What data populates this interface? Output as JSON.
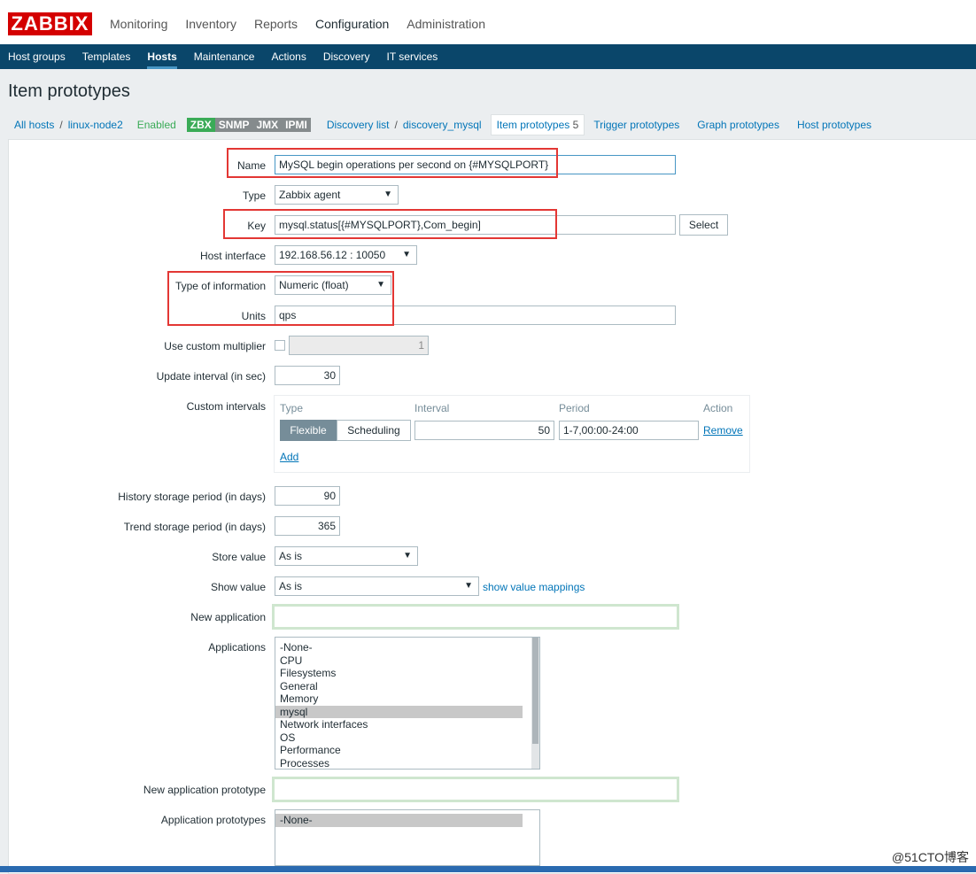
{
  "logo": "ZABBIX",
  "main_nav": [
    "Monitoring",
    "Inventory",
    "Reports",
    "Configuration",
    "Administration"
  ],
  "sub_nav": [
    "Host groups",
    "Templates",
    "Hosts",
    "Maintenance",
    "Actions",
    "Discovery",
    "IT services"
  ],
  "page_title": "Item prototypes",
  "breadcrumb": {
    "all_hosts": "All hosts",
    "host": "linux-node2",
    "status": "Enabled",
    "tags": [
      "ZBX",
      "SNMP",
      "JMX",
      "IPMI"
    ],
    "discovery_list": "Discovery list",
    "discovery": "discovery_mysql",
    "item_prototypes": "Item prototypes",
    "item_count": "5",
    "trigger_prototypes": "Trigger prototypes",
    "graph_prototypes": "Graph prototypes",
    "host_prototypes": "Host prototypes"
  },
  "form": {
    "name_label": "Name",
    "name_value": "MySQL begin operations per second on {#MYSQLPORT}",
    "type_label": "Type",
    "type_value": "Zabbix agent",
    "key_label": "Key",
    "key_value": "mysql.status[{#MYSQLPORT},Com_begin]",
    "select_button": "Select",
    "host_interface_label": "Host interface",
    "host_interface_value": "192.168.56.12 : 10050",
    "type_of_info_label": "Type of information",
    "type_of_info_value": "Numeric (float)",
    "units_label": "Units",
    "units_value": "qps",
    "custom_multiplier_label": "Use custom multiplier",
    "custom_multiplier_value": "1",
    "update_interval_label": "Update interval (in sec)",
    "update_interval_value": "30",
    "custom_intervals_label": "Custom intervals",
    "ci_headers": [
      "Type",
      "Interval",
      "Period",
      "Action"
    ],
    "ci_flexible": "Flexible",
    "ci_scheduling": "Scheduling",
    "ci_interval": "50",
    "ci_period": "1-7,00:00-24:00",
    "ci_remove": "Remove",
    "ci_add": "Add",
    "history_label": "History storage period (in days)",
    "history_value": "90",
    "trend_label": "Trend storage period (in days)",
    "trend_value": "365",
    "store_value_label": "Store value",
    "store_value_value": "As is",
    "show_value_label": "Show value",
    "show_value_value": "As is",
    "show_value_mappings": "show value mappings",
    "new_application_label": "New application",
    "applications_label": "Applications",
    "applications": [
      "-None-",
      "CPU",
      "Filesystems",
      "General",
      "Memory",
      "mysql",
      "Network interfaces",
      "OS",
      "Performance",
      "Processes"
    ],
    "applications_selected": "mysql",
    "new_app_prototype_label": "New application prototype",
    "app_prototypes_label": "Application prototypes",
    "app_prototypes": [
      "-None-"
    ]
  },
  "watermark": "@51CTO博客"
}
